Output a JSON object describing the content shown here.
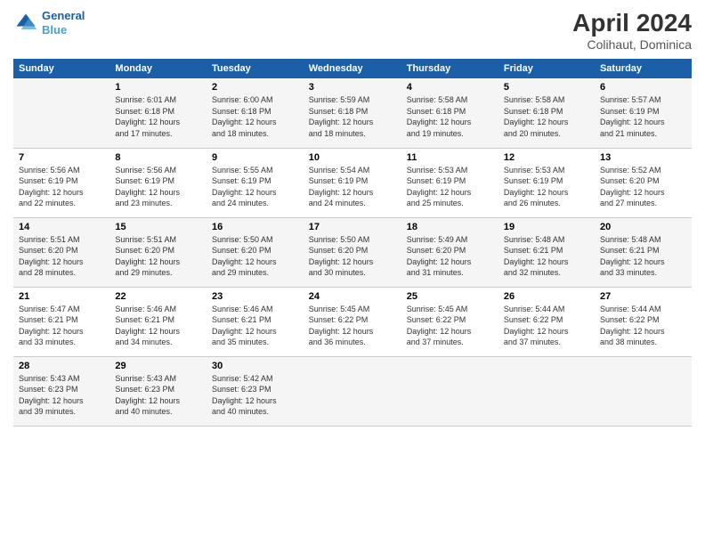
{
  "header": {
    "logo_line1": "General",
    "logo_line2": "Blue",
    "title": "April 2024",
    "location": "Colihaut, Dominica"
  },
  "days_of_week": [
    "Sunday",
    "Monday",
    "Tuesday",
    "Wednesday",
    "Thursday",
    "Friday",
    "Saturday"
  ],
  "weeks": [
    [
      {
        "num": "",
        "info": ""
      },
      {
        "num": "1",
        "info": "Sunrise: 6:01 AM\nSunset: 6:18 PM\nDaylight: 12 hours\nand 17 minutes."
      },
      {
        "num": "2",
        "info": "Sunrise: 6:00 AM\nSunset: 6:18 PM\nDaylight: 12 hours\nand 18 minutes."
      },
      {
        "num": "3",
        "info": "Sunrise: 5:59 AM\nSunset: 6:18 PM\nDaylight: 12 hours\nand 18 minutes."
      },
      {
        "num": "4",
        "info": "Sunrise: 5:58 AM\nSunset: 6:18 PM\nDaylight: 12 hours\nand 19 minutes."
      },
      {
        "num": "5",
        "info": "Sunrise: 5:58 AM\nSunset: 6:18 PM\nDaylight: 12 hours\nand 20 minutes."
      },
      {
        "num": "6",
        "info": "Sunrise: 5:57 AM\nSunset: 6:19 PM\nDaylight: 12 hours\nand 21 minutes."
      }
    ],
    [
      {
        "num": "7",
        "info": "Sunrise: 5:56 AM\nSunset: 6:19 PM\nDaylight: 12 hours\nand 22 minutes."
      },
      {
        "num": "8",
        "info": "Sunrise: 5:56 AM\nSunset: 6:19 PM\nDaylight: 12 hours\nand 23 minutes."
      },
      {
        "num": "9",
        "info": "Sunrise: 5:55 AM\nSunset: 6:19 PM\nDaylight: 12 hours\nand 24 minutes."
      },
      {
        "num": "10",
        "info": "Sunrise: 5:54 AM\nSunset: 6:19 PM\nDaylight: 12 hours\nand 24 minutes."
      },
      {
        "num": "11",
        "info": "Sunrise: 5:53 AM\nSunset: 6:19 PM\nDaylight: 12 hours\nand 25 minutes."
      },
      {
        "num": "12",
        "info": "Sunrise: 5:53 AM\nSunset: 6:19 PM\nDaylight: 12 hours\nand 26 minutes."
      },
      {
        "num": "13",
        "info": "Sunrise: 5:52 AM\nSunset: 6:20 PM\nDaylight: 12 hours\nand 27 minutes."
      }
    ],
    [
      {
        "num": "14",
        "info": "Sunrise: 5:51 AM\nSunset: 6:20 PM\nDaylight: 12 hours\nand 28 minutes."
      },
      {
        "num": "15",
        "info": "Sunrise: 5:51 AM\nSunset: 6:20 PM\nDaylight: 12 hours\nand 29 minutes."
      },
      {
        "num": "16",
        "info": "Sunrise: 5:50 AM\nSunset: 6:20 PM\nDaylight: 12 hours\nand 29 minutes."
      },
      {
        "num": "17",
        "info": "Sunrise: 5:50 AM\nSunset: 6:20 PM\nDaylight: 12 hours\nand 30 minutes."
      },
      {
        "num": "18",
        "info": "Sunrise: 5:49 AM\nSunset: 6:20 PM\nDaylight: 12 hours\nand 31 minutes."
      },
      {
        "num": "19",
        "info": "Sunrise: 5:48 AM\nSunset: 6:21 PM\nDaylight: 12 hours\nand 32 minutes."
      },
      {
        "num": "20",
        "info": "Sunrise: 5:48 AM\nSunset: 6:21 PM\nDaylight: 12 hours\nand 33 minutes."
      }
    ],
    [
      {
        "num": "21",
        "info": "Sunrise: 5:47 AM\nSunset: 6:21 PM\nDaylight: 12 hours\nand 33 minutes."
      },
      {
        "num": "22",
        "info": "Sunrise: 5:46 AM\nSunset: 6:21 PM\nDaylight: 12 hours\nand 34 minutes."
      },
      {
        "num": "23",
        "info": "Sunrise: 5:46 AM\nSunset: 6:21 PM\nDaylight: 12 hours\nand 35 minutes."
      },
      {
        "num": "24",
        "info": "Sunrise: 5:45 AM\nSunset: 6:22 PM\nDaylight: 12 hours\nand 36 minutes."
      },
      {
        "num": "25",
        "info": "Sunrise: 5:45 AM\nSunset: 6:22 PM\nDaylight: 12 hours\nand 37 minutes."
      },
      {
        "num": "26",
        "info": "Sunrise: 5:44 AM\nSunset: 6:22 PM\nDaylight: 12 hours\nand 37 minutes."
      },
      {
        "num": "27",
        "info": "Sunrise: 5:44 AM\nSunset: 6:22 PM\nDaylight: 12 hours\nand 38 minutes."
      }
    ],
    [
      {
        "num": "28",
        "info": "Sunrise: 5:43 AM\nSunset: 6:23 PM\nDaylight: 12 hours\nand 39 minutes."
      },
      {
        "num": "29",
        "info": "Sunrise: 5:43 AM\nSunset: 6:23 PM\nDaylight: 12 hours\nand 40 minutes."
      },
      {
        "num": "30",
        "info": "Sunrise: 5:42 AM\nSunset: 6:23 PM\nDaylight: 12 hours\nand 40 minutes."
      },
      {
        "num": "",
        "info": ""
      },
      {
        "num": "",
        "info": ""
      },
      {
        "num": "",
        "info": ""
      },
      {
        "num": "",
        "info": ""
      }
    ]
  ]
}
